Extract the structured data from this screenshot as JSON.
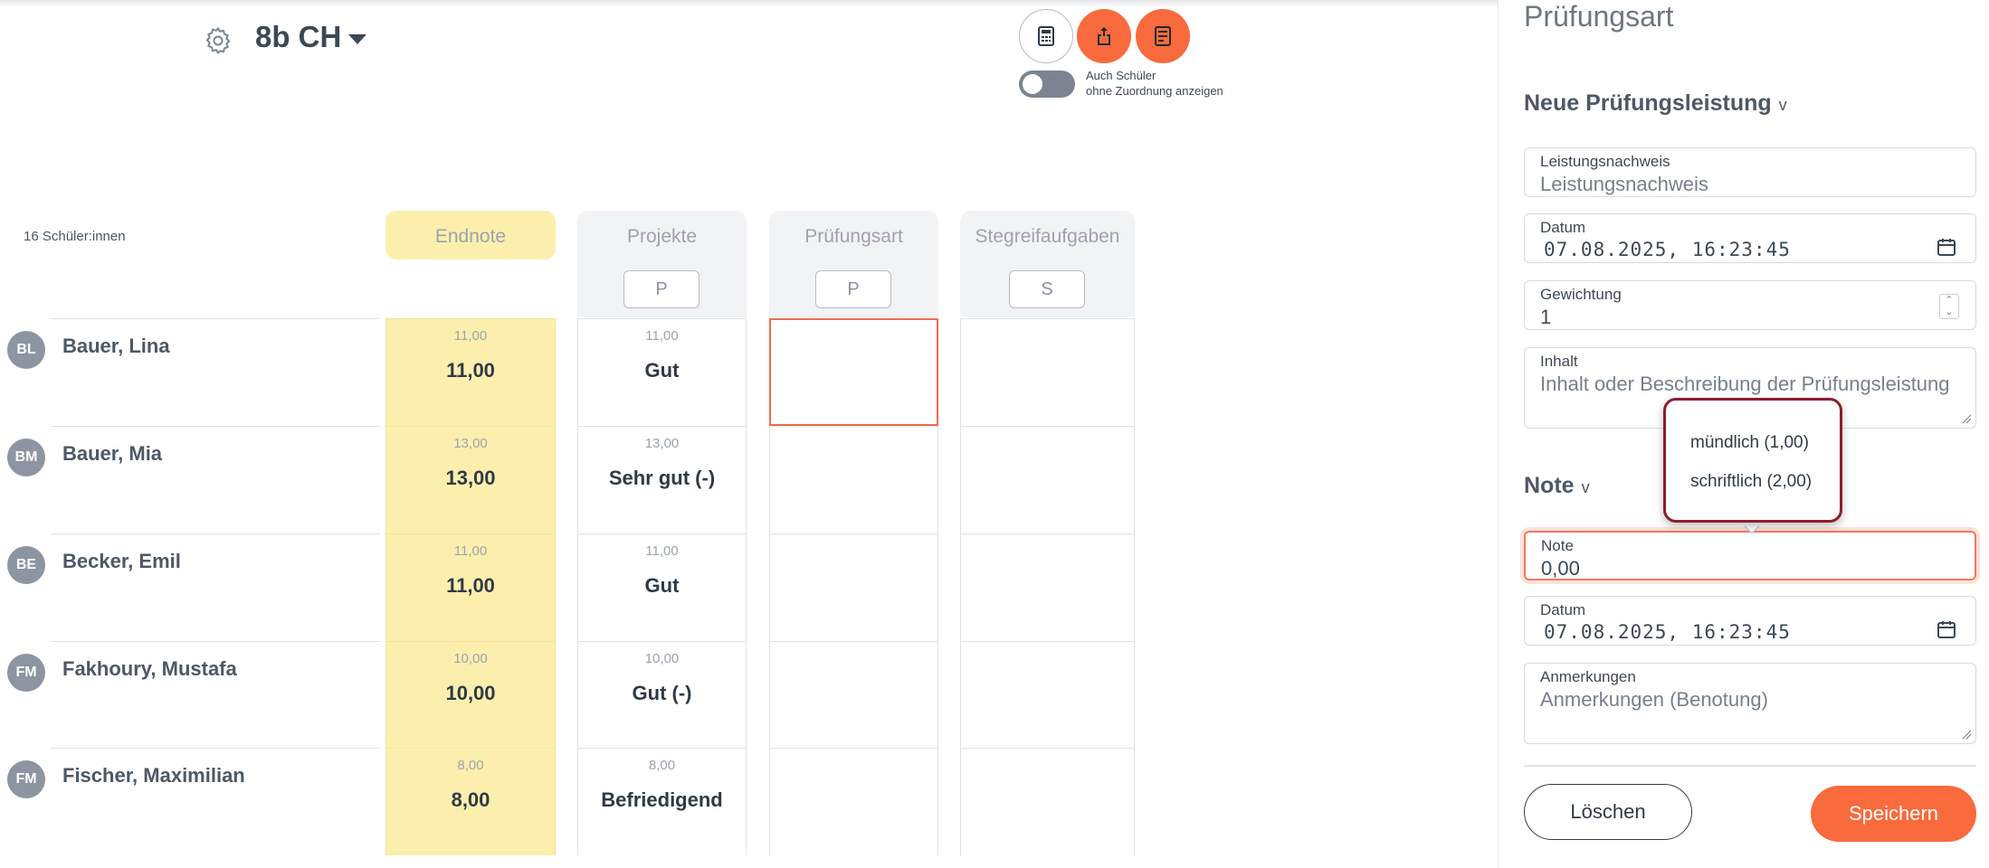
{
  "header": {
    "class_name": "8b CH",
    "toggle_label_line1": "Auch Schüler",
    "toggle_label_line2": "ohne Zuordnung anzeigen"
  },
  "table": {
    "student_count": "16 Schüler:innen",
    "columns": [
      {
        "label": "Endnote"
      },
      {
        "label": "Projekte",
        "chip": "P"
      },
      {
        "label": "Prüfungsart",
        "chip": "P"
      },
      {
        "label": "Stegreifaufgaben",
        "chip": "S"
      }
    ],
    "rows": [
      {
        "initials": "BL",
        "name": "Bauer, Lina",
        "endnote_small": "11,00",
        "endnote": "11,00",
        "proj_small": "11,00",
        "proj": "Gut"
      },
      {
        "initials": "BM",
        "name": "Bauer, Mia",
        "endnote_small": "13,00",
        "endnote": "13,00",
        "proj_small": "13,00",
        "proj": "Sehr gut (-)"
      },
      {
        "initials": "BE",
        "name": "Becker, Emil",
        "endnote_small": "11,00",
        "endnote": "11,00",
        "proj_small": "11,00",
        "proj": "Gut"
      },
      {
        "initials": "FM",
        "name": "Fakhoury, Mustafa",
        "endnote_small": "10,00",
        "endnote": "10,00",
        "proj_small": "10,00",
        "proj": "Gut (-)"
      },
      {
        "initials": "FM",
        "name": "Fischer, Maximilian",
        "endnote_small": "8,00",
        "endnote": "8,00",
        "proj_small": "8,00",
        "proj": "Befriedigend"
      }
    ]
  },
  "panel": {
    "title": "Prüfungsart",
    "section1_title": "Neue Prüfungsleistung",
    "leistungsnachweis_label": "Leistungsnachweis",
    "leistungsnachweis_placeholder": "Leistungsnachweis",
    "datum_label": "Datum",
    "datum_value": "07.08.2025, 16:23:45",
    "gewichtung_label": "Gewichtung",
    "gewichtung_value": "1",
    "inhalt_label": "Inhalt",
    "inhalt_placeholder": "Inhalt oder Beschreibung der Prüfungsleistung",
    "section2_title": "Note",
    "note_label": "Note",
    "note_value": "0,00",
    "datum2_label": "Datum",
    "datum2_value": "07.08.2025, 16:23:45",
    "anmerkungen_label": "Anmerkungen",
    "anmerkungen_placeholder": "Anmerkungen (Benotung)",
    "delete_label": "Löschen",
    "save_label": "Speichern"
  },
  "dropdown": {
    "options": [
      "mündlich (1,00)",
      "schriftlich (2,00)"
    ]
  },
  "colors": {
    "accent": "#f96a3c",
    "endnote_bg": "#fcefae",
    "popup_border": "#8b1e2e"
  }
}
